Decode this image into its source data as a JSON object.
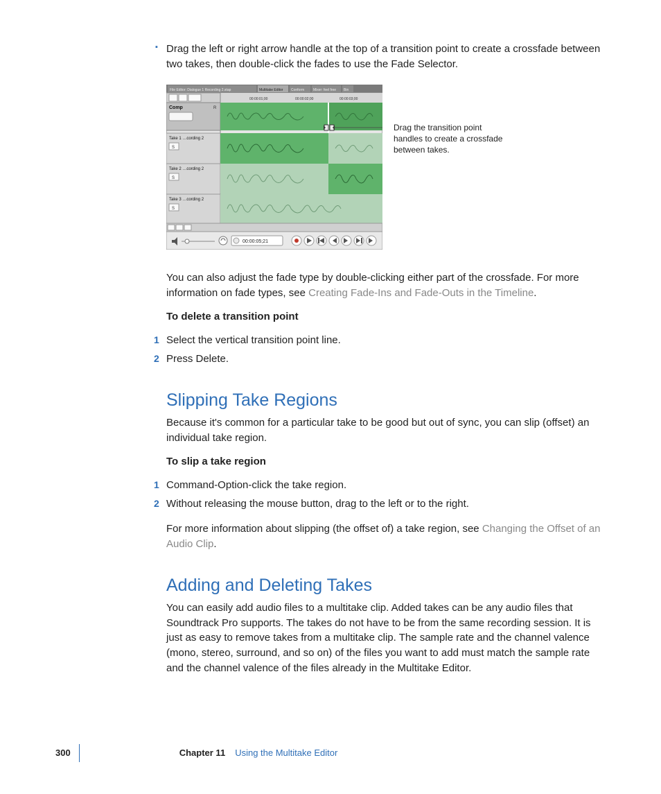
{
  "bullet_text": "Drag the left or right arrow handle at the top of a transition point to create a crossfade between two takes, then double-click the fades to use the Fade Selector.",
  "figure": {
    "file_title": "File Editor: Dialogue 1 Recording 2.stap",
    "tabs": [
      "Multitake Editor",
      "Conform",
      "Mixer: feel free",
      "Bin"
    ],
    "timecodes": [
      "00:00:01;00",
      "00:00:02;00",
      "00:00:03;00"
    ],
    "tracks": {
      "comp": "Comp",
      "t1": "Take 1  …cording 2",
      "t2": "Take 2  …cording 2",
      "t3": "Take 3  …cording 2",
      "solo": "S",
      "r": "R"
    },
    "transport_time": "00:00:05;21",
    "callout": "Drag the transition point handles to create a crossfade between takes."
  },
  "para_fade_adjust_a": "You can also adjust the fade type by double-clicking either part of the crossfade. For more information on fade types, see ",
  "para_fade_adjust_link": "Creating Fade-Ins and Fade-Outs in the Timeline",
  "para_fade_adjust_b": ".",
  "delete_heading": "To delete a transition point",
  "delete_steps": [
    "Select the vertical transition point line.",
    "Press Delete."
  ],
  "section_slip": "Slipping Take Regions",
  "slip_intro": "Because it's common for a particular take to be good but out of sync, you can slip (offset) an individual take region.",
  "slip_heading": "To slip a take region",
  "slip_steps": [
    "Command-Option-click the take region.",
    "Without releasing the mouse button, drag to the left or to the right."
  ],
  "slip_more_a": "For more information about slipping (the offset of) a take region, see ",
  "slip_more_link": "Changing the Offset of an Audio Clip",
  "slip_more_b": ".",
  "section_add": "Adding and Deleting Takes",
  "add_para": "You can easily add audio files to a multitake clip. Added takes can be any audio files that Soundtrack Pro supports. The takes do not have to be from the same recording session. It is just as easy to remove takes from a multitake clip. The sample rate and the channel valence (mono, stereo, surround, and so on) of the files you want to add must match the sample rate and the channel valence of the files already in the Multitake Editor.",
  "footer": {
    "page": "300",
    "chapter_label": "Chapter 11",
    "chapter_title": "Using the Multitake Editor"
  },
  "step_numbers": [
    "1",
    "2"
  ]
}
